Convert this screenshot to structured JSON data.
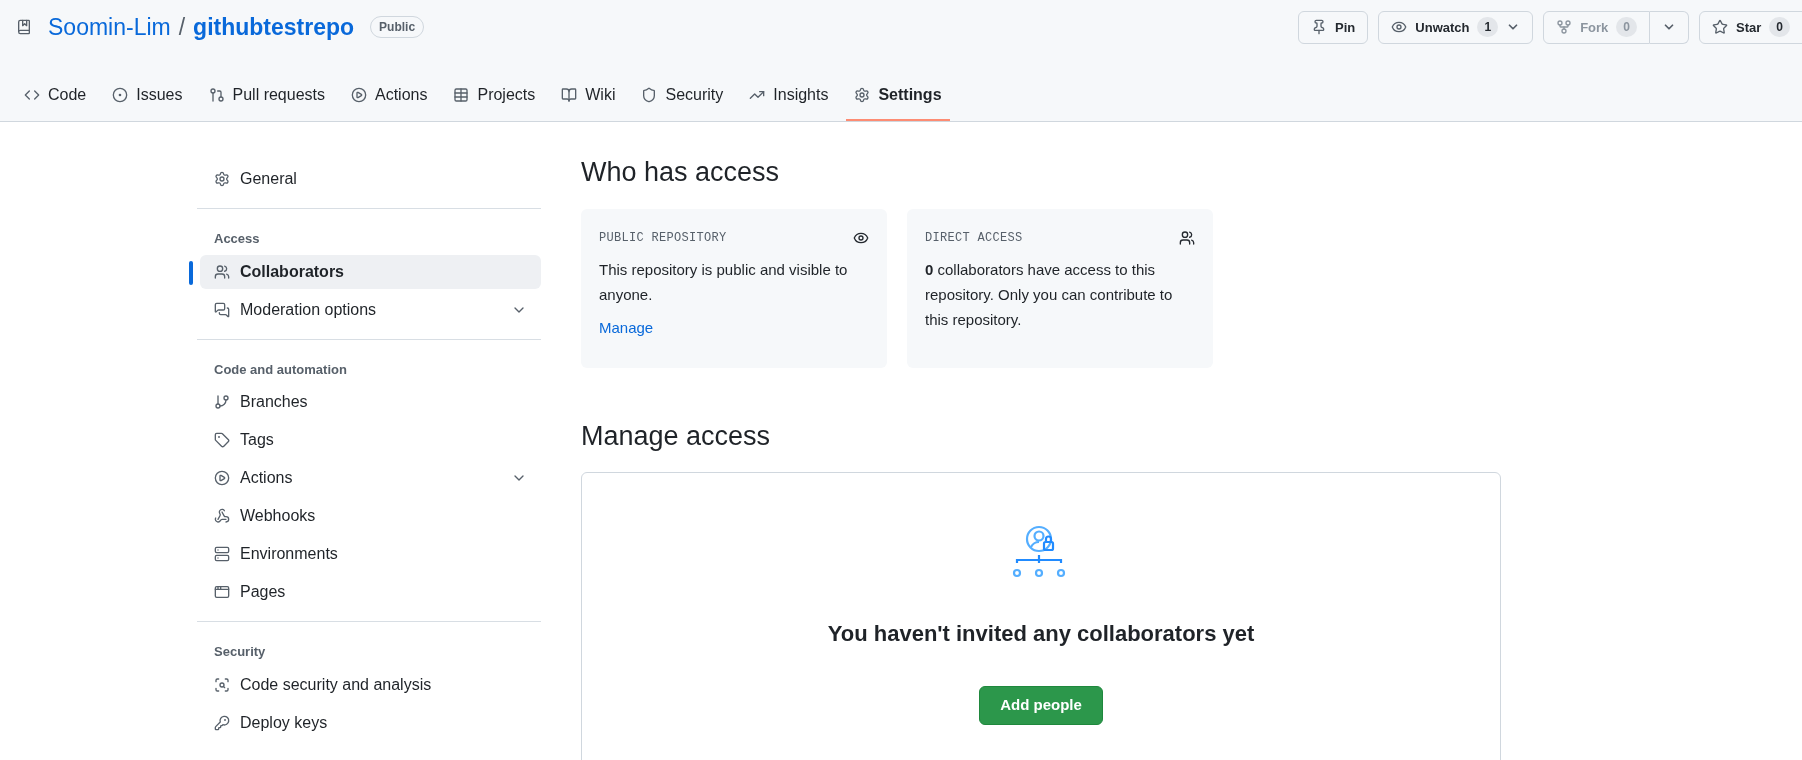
{
  "repo": {
    "owner": "Soomin-Lim",
    "separator": "/",
    "name": "githubtestrepo",
    "visibility": "Public"
  },
  "actions": [
    {
      "kind": "pin",
      "label": "Pin",
      "disabled": false
    },
    {
      "kind": "watch",
      "label": "Unwatch",
      "count": "1",
      "disabled": false
    },
    {
      "kind": "fork",
      "label": "Fork",
      "count": "0",
      "disabled": true
    },
    {
      "kind": "star",
      "label": "Star",
      "count": "0",
      "disabled": false
    }
  ],
  "tabs": [
    {
      "label": "Code",
      "selected": false
    },
    {
      "label": "Issues",
      "selected": false
    },
    {
      "label": "Pull requests",
      "selected": false
    },
    {
      "label": "Actions",
      "selected": false
    },
    {
      "label": "Projects",
      "selected": false
    },
    {
      "label": "Wiki",
      "selected": false
    },
    {
      "label": "Security",
      "selected": false
    },
    {
      "label": "Insights",
      "selected": false
    },
    {
      "label": "Settings",
      "selected": true
    }
  ],
  "sidebar": [
    {
      "items": [
        {
          "label": "General",
          "selected": false,
          "expandable": false
        }
      ]
    },
    {
      "heading": "Access",
      "items": [
        {
          "label": "Collaborators",
          "selected": true,
          "expandable": false
        },
        {
          "label": "Moderation options",
          "selected": false,
          "expandable": true
        }
      ]
    },
    {
      "heading": "Code and automation",
      "items": [
        {
          "label": "Branches",
          "selected": false,
          "expandable": false
        },
        {
          "label": "Tags",
          "selected": false,
          "expandable": false
        },
        {
          "label": "Actions",
          "selected": false,
          "expandable": true
        },
        {
          "label": "Webhooks",
          "selected": false,
          "expandable": false
        },
        {
          "label": "Environments",
          "selected": false,
          "expandable": false
        },
        {
          "label": "Pages",
          "selected": false,
          "expandable": false
        }
      ]
    },
    {
      "heading": "Security",
      "items": [
        {
          "label": "Code security and analysis",
          "selected": false,
          "expandable": false
        },
        {
          "label": "Deploy keys",
          "selected": false,
          "expandable": false
        }
      ]
    }
  ],
  "who_has_access": {
    "title": "Who has access",
    "cards": [
      {
        "label": "PUBLIC REPOSITORY",
        "text": "This repository is public and visible to anyone.",
        "link": "Manage"
      },
      {
        "label": "DIRECT ACCESS",
        "text": "**0** collaborators have access to this repository. Only you can contribute to this repository."
      }
    ]
  },
  "manage_access": {
    "title": "Manage access",
    "empty_message": "You haven't invited any collaborators yet",
    "button": "Add people"
  }
}
